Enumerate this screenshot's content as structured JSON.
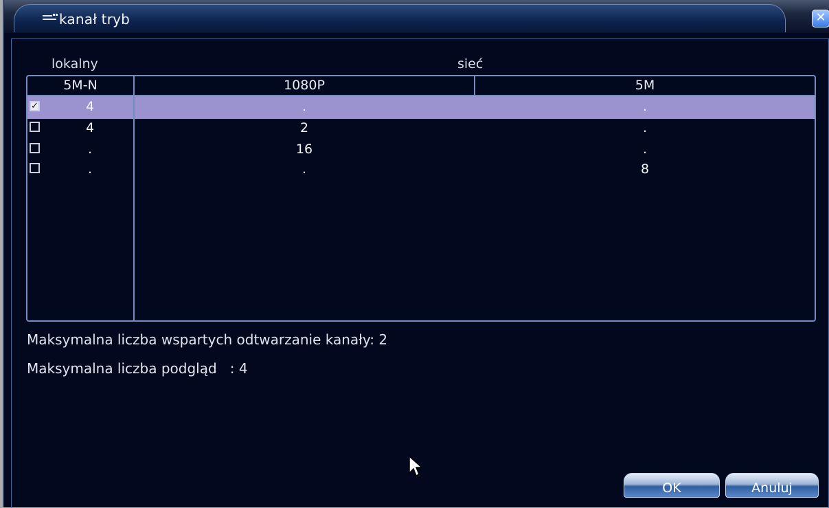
{
  "window": {
    "title": "kanał tryb"
  },
  "table": {
    "group_headers": {
      "local": "lokalny",
      "network": "sieć"
    },
    "columns": [
      "5M-N",
      "1080P",
      "5M"
    ],
    "rows": [
      {
        "checked": true,
        "c1": "4",
        "c2": ".",
        "c3": "."
      },
      {
        "checked": false,
        "c1": "4",
        "c2": "2",
        "c3": "."
      },
      {
        "checked": false,
        "c1": ".",
        "c2": "16",
        "c3": "."
      },
      {
        "checked": false,
        "c1": ".",
        "c2": ".",
        "c3": "8"
      }
    ]
  },
  "info": {
    "playback_label": "Maksymalna liczba wspartych odtwarzanie kanały: 2",
    "preview_label": "Maksymalna liczba podgląd   : 4"
  },
  "buttons": {
    "ok": "OK",
    "cancel": "Anuluj"
  },
  "icons": {
    "title": "channel-icon",
    "close": "close-icon",
    "cursor": "mouse-cursor-icon"
  }
}
